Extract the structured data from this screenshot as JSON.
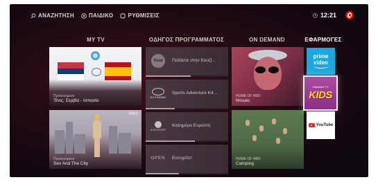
{
  "nav": [
    {
      "label": "ΑΝΑΖΗΤΗΣΗ",
      "icon": "search-icon"
    },
    {
      "label": "ΠΑΙΔΙΚΟ",
      "icon": "kids-icon"
    },
    {
      "label": "ΡΥΘΜΙΣΕΙΣ",
      "icon": "settings-icon"
    }
  ],
  "clock": {
    "time": "12:21",
    "icon": "clock-icon"
  },
  "brand": {
    "logo": "vodafone-logo",
    "color": "#e60000"
  },
  "columns": {
    "mytv": "MY TV",
    "guide": "ΟΔΗΓΟΣ ΠΡΟΓΡΑΜΜΑΤΟΣ",
    "ondemand": "ON DEMAND",
    "apps": "ΕΦΑΡΜΟΓΕΣ"
  },
  "mytv": [
    {
      "subtitle": "Προτεινόμενα",
      "title": "Τένις: Σερβία - Ισπανία"
    },
    {
      "subtitle": "Προτεινόμενα",
      "title": "Sex And The City",
      "badge": "HBO"
    }
  ],
  "guide": [
    {
      "channel_logo": "food",
      "title": "Πεδάστε στην Κουζί...",
      "progress": 0.55
    },
    {
      "channel_logo": "EXTREME",
      "title": "Sports Adventure K4...",
      "progress": 0.35
    },
    {
      "channel_logo": "EUROSPORT",
      "title": "Καλημέρα Ευρώπη",
      "progress": 0.6
    },
    {
      "channel_logo": "OPEN",
      "title": "Ευτυχείτε!",
      "progress": 0.4
    }
  ],
  "ondemand": [
    {
      "subtitle": "HOME OF HBO",
      "title": "Mosaic"
    },
    {
      "subtitle": "HOME OF HBO",
      "title": "Camping"
    }
  ],
  "apps": {
    "prime": {
      "line1": "prime",
      "line2": "video"
    },
    "kids": {
      "small": "Vodafone TV",
      "big": "KIDS"
    },
    "youtube": {
      "label": "YouTube"
    }
  },
  "colors": {
    "accent": "#e60000",
    "prime": "#1aa8e0",
    "kids": "#9b3b93"
  }
}
